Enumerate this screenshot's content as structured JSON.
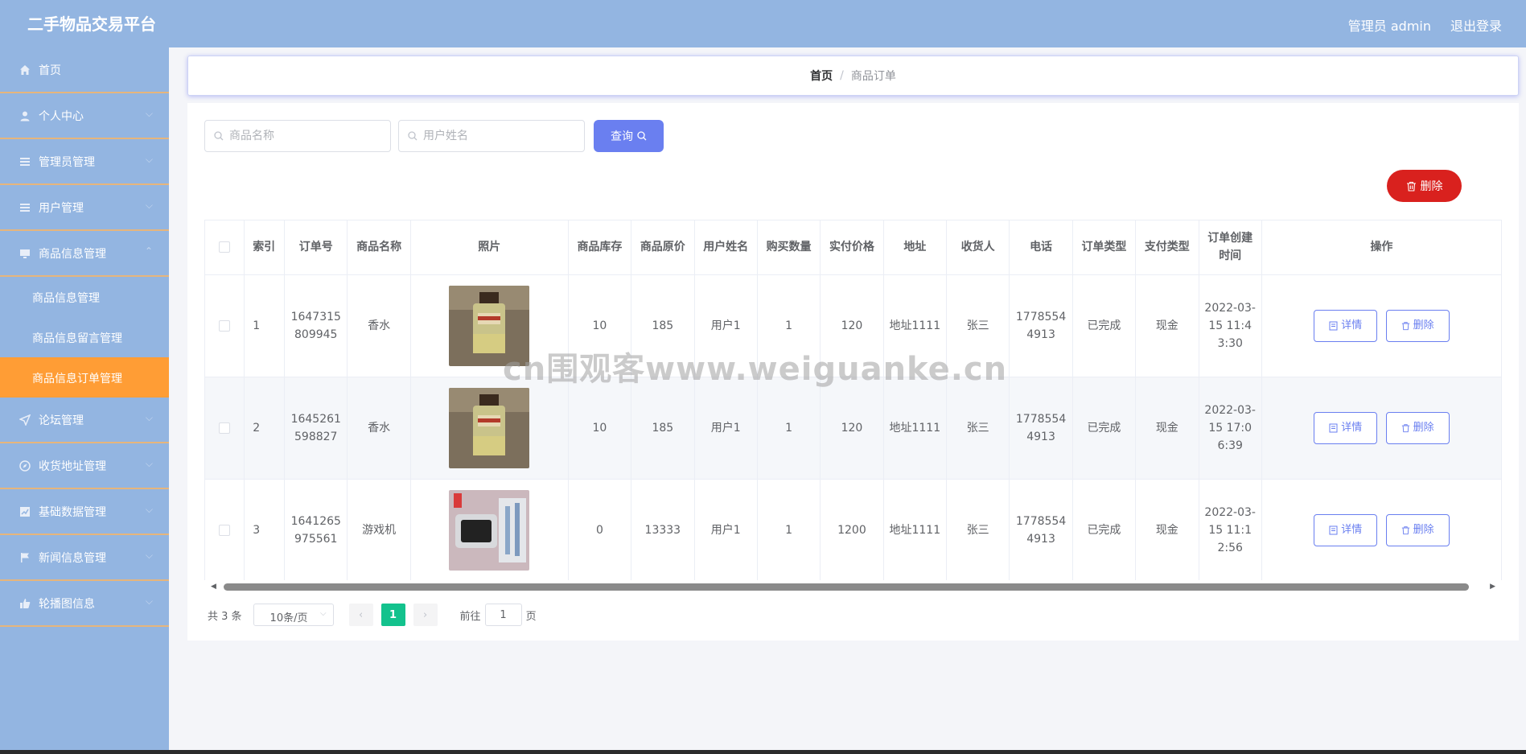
{
  "header": {
    "title": "二手物品交易平台",
    "admin": "管理员 admin",
    "logout": "退出登录"
  },
  "colors": {
    "header": "#93b5e1",
    "active": "#ff9d35",
    "primary": "#6a7ff0",
    "danger": "#d9211e",
    "page_active": "#13c28d"
  },
  "sidebar": {
    "items": [
      {
        "label": "首页",
        "icon": "home-icon"
      },
      {
        "label": "个人中心",
        "icon": "user-icon"
      },
      {
        "label": "管理员管理",
        "icon": "menu-icon"
      },
      {
        "label": "用户管理",
        "icon": "menu-icon"
      },
      {
        "label": "商品信息管理",
        "icon": "monitor-icon"
      }
    ],
    "sub_items": [
      {
        "label": "商品信息管理"
      },
      {
        "label": "商品信息留言管理"
      },
      {
        "label": "商品信息订单管理"
      }
    ],
    "items_after": [
      {
        "label": "论坛管理",
        "icon": "send-icon"
      },
      {
        "label": "收货地址管理",
        "icon": "compass-icon"
      },
      {
        "label": "基础数据管理",
        "icon": "chart-icon"
      },
      {
        "label": "新闻信息管理",
        "icon": "flag-icon"
      },
      {
        "label": "轮播图信息",
        "icon": "thumb-icon"
      }
    ]
  },
  "breadcrumb": {
    "home": "首页",
    "sep": "/",
    "current": "商品订单"
  },
  "search": {
    "product_placeholder": "商品名称",
    "user_placeholder": "用户姓名",
    "query_label": "查询",
    "delete_label": "删除"
  },
  "table": {
    "columns": [
      "索引",
      "订单号",
      "商品名称",
      "照片",
      "商品库存",
      "商品原价",
      "用户姓名",
      "购买数量",
      "实付价格",
      "地址",
      "收货人",
      "电话",
      "订单类型",
      "支付类型",
      "订单创建时间",
      "操作"
    ],
    "rows": [
      {
        "index": "1",
        "order_no": "1647315809945",
        "product": "香水",
        "photo": "perfume",
        "stock": "10",
        "price": "185",
        "user": "用户1",
        "qty": "1",
        "paid": "120",
        "address": "地址1111",
        "receiver": "张三",
        "phone": "17785544913",
        "order_type": "已完成",
        "pay_type": "现金",
        "created": "2022-03-15 11:43:30"
      },
      {
        "index": "2",
        "order_no": "1645261598827",
        "product": "香水",
        "photo": "perfume",
        "stock": "10",
        "price": "185",
        "user": "用户1",
        "qty": "1",
        "paid": "120",
        "address": "地址1111",
        "receiver": "张三",
        "phone": "17785544913",
        "order_type": "已完成",
        "pay_type": "现金",
        "created": "2022-03-15 17:06:39"
      },
      {
        "index": "3",
        "order_no": "1641265975561",
        "product": "游戏机",
        "photo": "console",
        "stock": "0",
        "price": "13333",
        "user": "用户1",
        "qty": "1",
        "paid": "1200",
        "address": "地址1111",
        "receiver": "张三",
        "phone": "17785544913",
        "order_type": "已完成",
        "pay_type": "现金",
        "created": "2022-03-15 11:12:56"
      }
    ],
    "detail_label": "详情",
    "delete_label": "删除"
  },
  "pagination": {
    "total": "共 3 条",
    "page_size": "10条/页",
    "current_page": "1",
    "goto_prefix": "前往",
    "goto_value": "1",
    "goto_suffix": "页"
  },
  "watermark": "cn围观客www.weiguanke.cn"
}
